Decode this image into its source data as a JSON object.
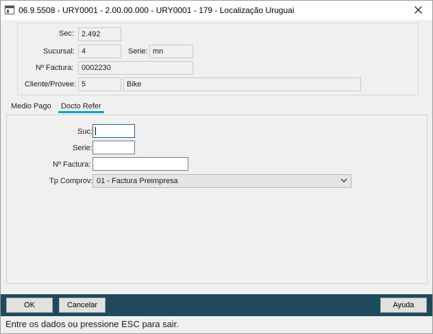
{
  "window": {
    "title": "06.9.5508 - URY0001 - 2.00.00.000 - URY0001 - 179 - Localização Uruguai"
  },
  "header": {
    "sec_label": "Sec:",
    "sec_value": "2.492",
    "sucursal_label": "Sucursal:",
    "sucursal_value": "4",
    "serie_label": "Serie:",
    "serie_value": "mn",
    "factura_label": "Nº Factura:",
    "factura_value": "0002230",
    "cliente_label": "Cliente/Provee:",
    "cliente_code": "5",
    "cliente_name": "Bike"
  },
  "tabs": [
    {
      "label": "Medio Pago",
      "active": false
    },
    {
      "label": "Docto Refer",
      "active": true
    }
  ],
  "docto_refer": {
    "suc_label": "Suc:",
    "suc_value": "",
    "serie_label": "Serie:",
    "serie_value": "",
    "factura_label": "Nº Factura:",
    "factura_value": "",
    "tp_comprov_label": "Tp Comprov:",
    "tp_comprov_selected": "01 - Factura Preimpresa"
  },
  "buttons": {
    "ok": "OK",
    "cancelar": "Cancelar",
    "ayuda": "Ayuda"
  },
  "status": {
    "message": "Entre os dados ou pressione ESC para sair."
  },
  "colors": {
    "accent": "#00a0c8",
    "bottom_bar": "#1f4a5c",
    "panel_bg": "#f0f0f0"
  },
  "icons": {
    "app": "app-window-icon",
    "close": "close-icon",
    "dropdown": "chevron-down-icon"
  }
}
